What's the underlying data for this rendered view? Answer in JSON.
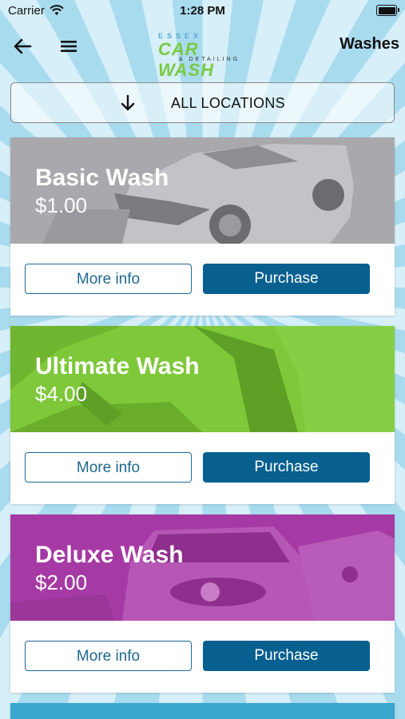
{
  "status_bar": {
    "carrier": "Carrier",
    "time": "1:28 PM"
  },
  "nav": {
    "title": "Washes"
  },
  "logo": {
    "line1": "ESSEX",
    "line2": "CAR WASH",
    "line3": "& DETAILING"
  },
  "location_selector": {
    "label": "ALL LOCATIONS"
  },
  "washes": [
    {
      "name": "Basic Wash",
      "price": "$1.00",
      "more_label": "More info",
      "purchase_label": "Purchase",
      "color": "#a9a9ad"
    },
    {
      "name": "Ultimate Wash",
      "price": "$4.00",
      "more_label": "More info",
      "purchase_label": "Purchase",
      "color": "#7ec83a"
    },
    {
      "name": "Deluxe Wash",
      "price": "$2.00",
      "more_label": "More info",
      "purchase_label": "Purchase",
      "color": "#a63aa5"
    }
  ],
  "colors": {
    "accent": "#07608f",
    "background": "#bfe4f2",
    "peek_card": "#3aa7d0"
  }
}
